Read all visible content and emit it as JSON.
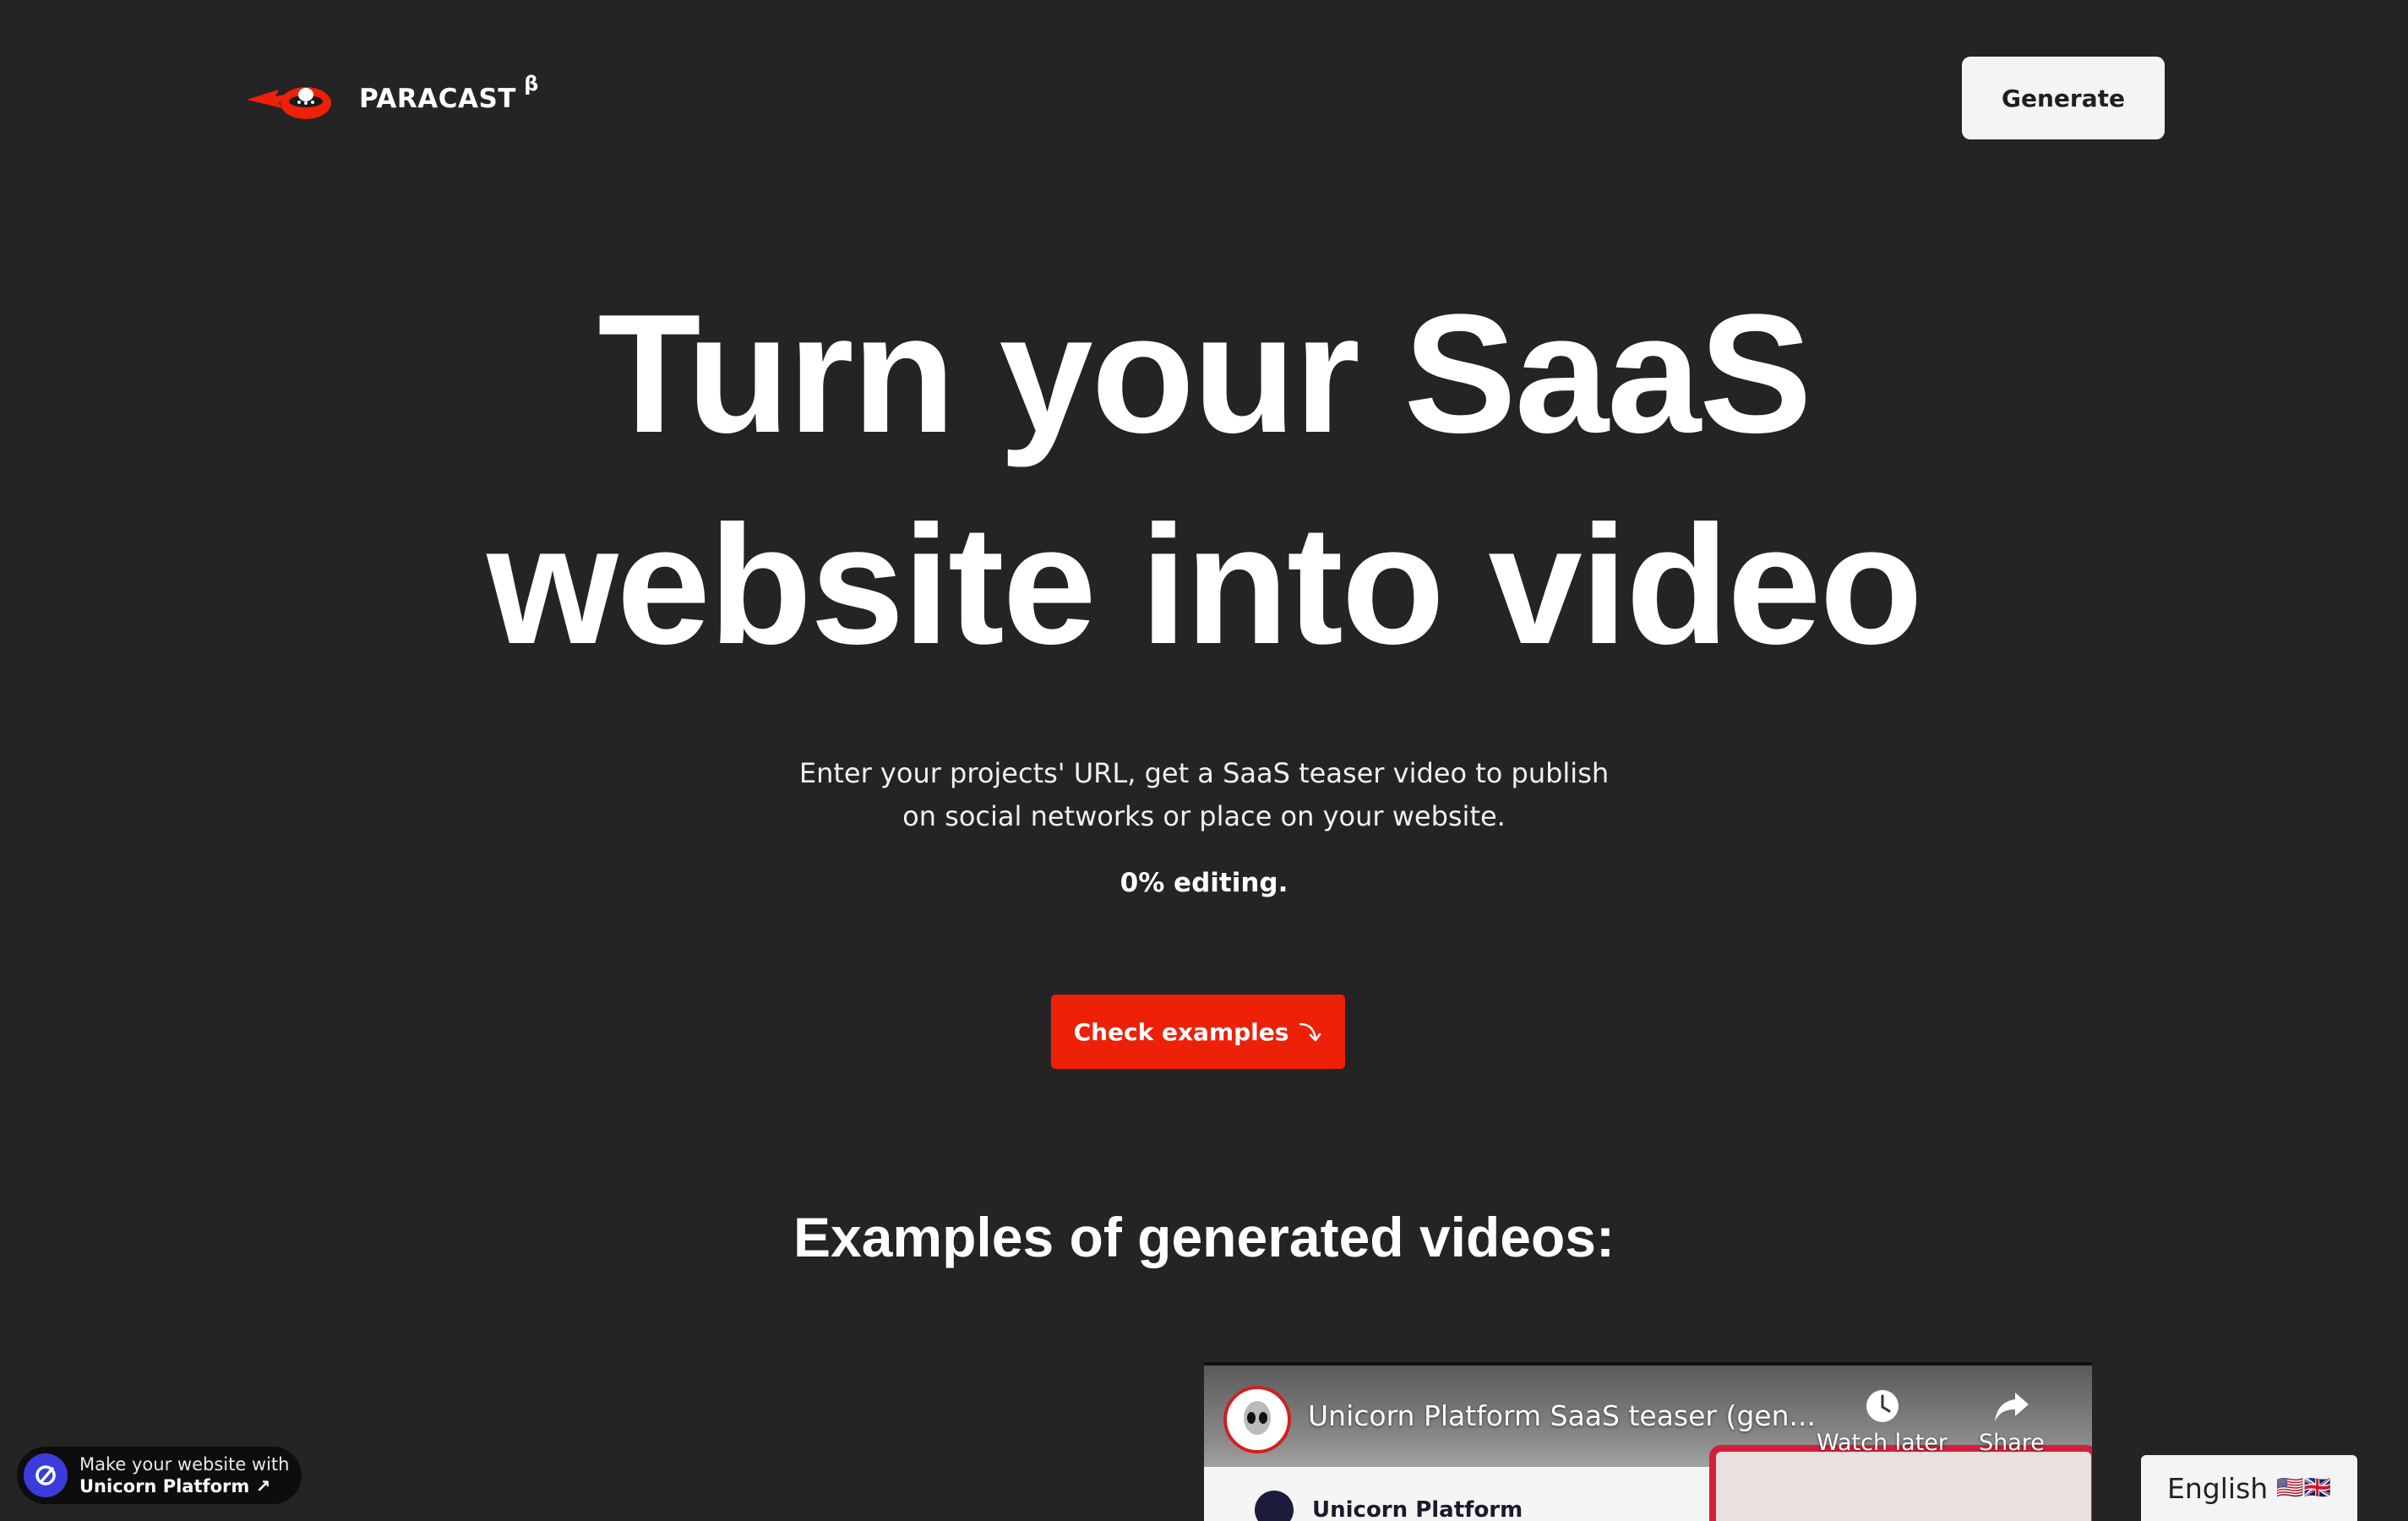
{
  "nav": {
    "brand": "PARACAST",
    "beta": "β",
    "generate_label": "Generate"
  },
  "hero": {
    "title_line1": "Turn your SaaS",
    "title_line2": "website into video",
    "subtitle_line1": "Enter your projects' URL, get a SaaS teaser video to publish",
    "subtitle_line2": "on social networks or place on your website.",
    "emphasis": "0% editing.",
    "cta_label": "Check examples",
    "cta_icon": "curved-arrow-down-icon"
  },
  "examples": {
    "title": "Examples of generated videos:",
    "video": {
      "title": "Unicorn Platform SaaS teaser (gen...",
      "watch_later": "Watch later",
      "share": "Share",
      "channel": "Unicorn Platform"
    }
  },
  "badge": {
    "line1": "Make your website with",
    "line2": "Unicorn Platform ↗"
  },
  "language": {
    "label": "English",
    "flags": "🇺🇸🇬🇧"
  },
  "colors": {
    "background": "#242424",
    "accent": "#ec2108",
    "button_light": "#f4f4f4"
  }
}
